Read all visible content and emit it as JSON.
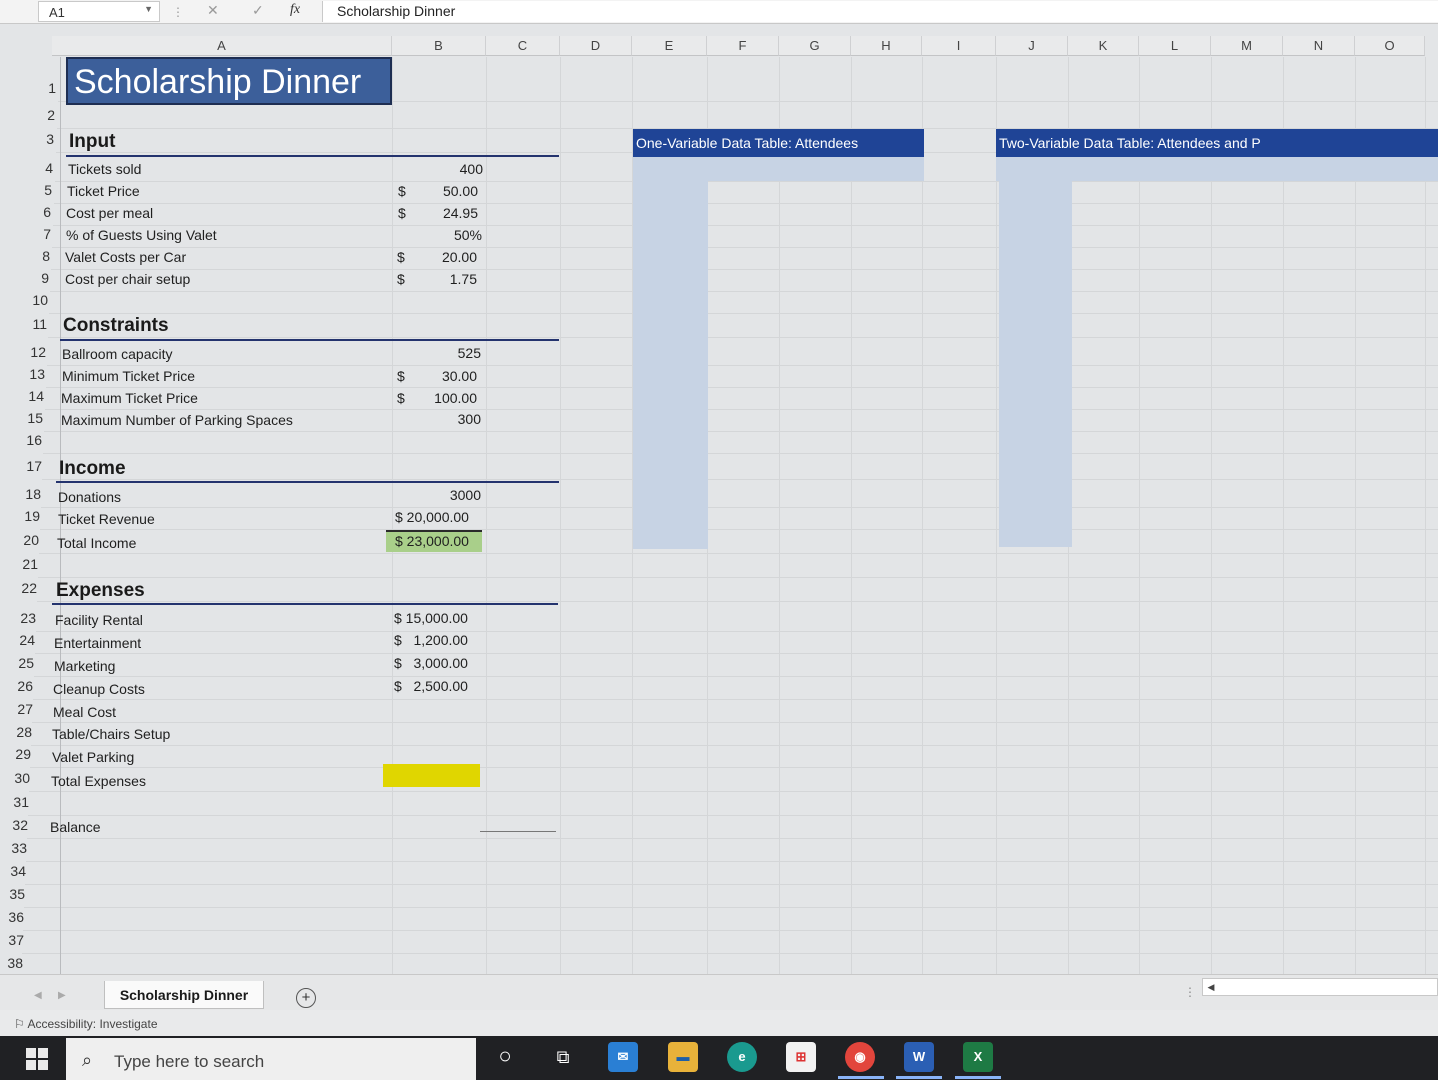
{
  "formula_bar": {
    "name_box": "A1",
    "fx": "fx",
    "content": "Scholarship Dinner"
  },
  "columns": [
    "A",
    "B",
    "C",
    "D",
    "E",
    "F",
    "G",
    "H",
    "I",
    "J",
    "K",
    "L",
    "M",
    "N",
    "O"
  ],
  "rows": [
    "1",
    "2",
    "3",
    "4",
    "5",
    "6",
    "7",
    "8",
    "9",
    "10",
    "11",
    "12",
    "13",
    "14",
    "15",
    "16",
    "17",
    "18",
    "19",
    "20",
    "21",
    "22",
    "23",
    "24",
    "25",
    "26",
    "27",
    "28",
    "29",
    "30",
    "31",
    "32",
    "33",
    "34",
    "35",
    "36",
    "37",
    "38"
  ],
  "title": "Scholarship Dinner",
  "sections": {
    "input": "Input",
    "constraints": "Constraints",
    "income": "Income",
    "expenses": "Expenses"
  },
  "input": [
    {
      "label": "Tickets sold",
      "currency": "",
      "value": "400"
    },
    {
      "label": "Ticket Price",
      "currency": "$",
      "value": "50.00"
    },
    {
      "label": "Cost per meal",
      "currency": "$",
      "value": "24.95"
    },
    {
      "label": "% of Guests Using Valet",
      "currency": "",
      "value": "50%"
    },
    {
      "label": "Valet Costs per Car",
      "currency": "$",
      "value": "20.00"
    },
    {
      "label": "Cost per chair setup",
      "currency": "$",
      "value": "1.75"
    }
  ],
  "constraints": [
    {
      "label": "Ballroom capacity",
      "currency": "",
      "value": "525"
    },
    {
      "label": "Minimum Ticket Price",
      "currency": "$",
      "value": "30.00"
    },
    {
      "label": "Maximum Ticket Price",
      "currency": "$",
      "value": "100.00"
    },
    {
      "label": "Maximum Number of Parking Spaces",
      "currency": "",
      "value": "300"
    }
  ],
  "income": [
    {
      "label": "Donations",
      "value": "3000"
    },
    {
      "label": "Ticket Revenue",
      "value": "$ 20,000.00"
    },
    {
      "label": "Total Income",
      "value": "$ 23,000.00"
    }
  ],
  "expenses": [
    {
      "label": "Facility Rental",
      "value": "$ 15,000.00"
    },
    {
      "label": "Entertainment",
      "value": "$   1,200.00"
    },
    {
      "label": "Marketing",
      "value": "$   3,000.00"
    },
    {
      "label": "Cleanup Costs",
      "value": "$   2,500.00"
    },
    {
      "label": "Meal Cost",
      "value": ""
    },
    {
      "label": "Table/Chairs Setup",
      "value": ""
    },
    {
      "label": "Valet Parking",
      "value": ""
    },
    {
      "label": "Total Expenses",
      "value": ""
    }
  ],
  "balance_label": "Balance",
  "data_tables": {
    "one_variable": "One-Variable Data Table: Attendees",
    "two_variable": "Two-Variable Data Table: Attendees and P"
  },
  "sheet_tabs": {
    "active": "Scholarship Dinner",
    "add": "+"
  },
  "status_bar": {
    "accessibility": "Accessibility: Investigate"
  },
  "taskbar": {
    "search_placeholder": "Type here to search",
    "apps": [
      "cortana-icon",
      "task-view-icon",
      "mail-icon",
      "file-explorer-icon",
      "edge-icon",
      "store-icon",
      "chrome-icon",
      "word-icon",
      "excel-icon"
    ]
  },
  "colors": {
    "title_fill": "#3c5f9a",
    "table_header": "#1f4496",
    "table_fill": "#c7d3e4",
    "total_income_fill": "#a9cf8a",
    "total_expenses_fill": "#e0d600"
  }
}
